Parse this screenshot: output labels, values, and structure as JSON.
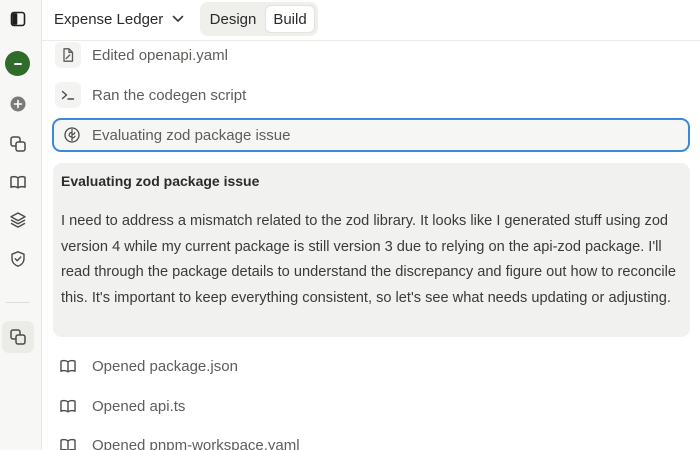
{
  "header": {
    "project_name": "Expense Ledger",
    "modes": [
      {
        "label": "Design",
        "selected": false
      },
      {
        "label": "Build",
        "selected": true
      }
    ]
  },
  "sidebar": {
    "items": [
      {
        "icon": "sidebar-toggle-icon"
      },
      {
        "icon": "avatar"
      },
      {
        "icon": "plus-circle-icon"
      },
      {
        "icon": "copy-icon"
      },
      {
        "icon": "book-icon"
      },
      {
        "icon": "layers-icon"
      },
      {
        "icon": "shield-check-icon"
      },
      {
        "icon": "copy-icon",
        "active": true
      }
    ]
  },
  "activity": [
    {
      "icon": "file-edit-icon",
      "text": "Edited openapi.yaml"
    },
    {
      "icon": "terminal-icon",
      "text": "Ran the codegen script"
    },
    {
      "icon": "brain-icon",
      "text": "Evaluating zod package issue",
      "focused": true
    }
  ],
  "reasoning": {
    "title": "Evaluating zod package issue",
    "body": "I need to address a mismatch related to the zod library. It looks like I generated stuff using zod version 4 while my current package is still version 3 due to relying on the api-zod package. I'll read through the package details to understand the discrepancy and figure out how to reconcile this. It's important to keep everything consistent, so let's see what needs updating or adjusting."
  },
  "opened_files": [
    {
      "icon": "book-icon",
      "text": "Opened package.json"
    },
    {
      "icon": "book-icon",
      "text": "Opened api.ts"
    },
    {
      "icon": "book-icon",
      "text": "Opened pnpm-workspace.yaml"
    }
  ],
  "colors": {
    "focus_border": "#3b8ad9",
    "avatar": "#2f6b2a",
    "panel_bg": "#f1f1ef"
  }
}
